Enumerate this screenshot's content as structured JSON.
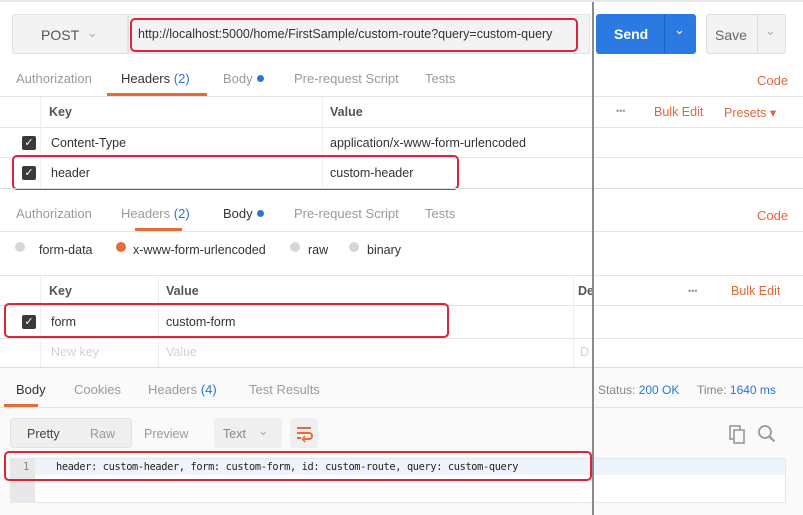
{
  "request": {
    "method": "POST",
    "url": "http://localhost:5000/home/FirstSample/custom-route?query=custom-query",
    "send_label": "Send",
    "save_label": "Save"
  },
  "request_tabs": {
    "authorization": "Authorization",
    "headers": "Headers",
    "headers_count": "(2)",
    "body": "Body",
    "prerequest": "Pre-request Script",
    "tests": "Tests",
    "code": "Code"
  },
  "headers_table": {
    "key_header": "Key",
    "value_header": "Value",
    "more": "•••",
    "bulk_edit": "Bulk Edit",
    "presets": "Presets ▾",
    "rows": [
      {
        "key": "Content-Type",
        "value": "application/x-www-form-urlencoded",
        "checked": true
      },
      {
        "key": "header",
        "value": "custom-header",
        "checked": true
      }
    ]
  },
  "body_options": {
    "form_data": "form-data",
    "urlencoded": "x-www-form-urlencoded",
    "raw": "raw",
    "binary": "binary",
    "selected": "x-www-form-urlencoded"
  },
  "body_table": {
    "key_header": "Key",
    "value_header": "Value",
    "desc_header": "De",
    "more": "•••",
    "bulk_edit": "Bulk Edit",
    "rows": [
      {
        "key": "form",
        "value": "custom-form",
        "checked": true
      }
    ],
    "new_key_placeholder": "New key",
    "new_value_placeholder": "Value",
    "new_desc_placeholder": "D"
  },
  "response": {
    "tabs": {
      "body": "Body",
      "cookies": "Cookies",
      "headers": "Headers",
      "headers_count": "(4)",
      "test_results": "Test Results"
    },
    "status_label": "Status:",
    "status_value": "200 OK",
    "time_label": "Time:",
    "time_value": "1640 ms",
    "view": {
      "pretty": "Pretty",
      "raw": "Raw",
      "preview": "Preview",
      "format": "Text"
    },
    "lines": [
      {
        "number": "1",
        "text": "header: custom-header, form: custom-form, id: custom-route, query: custom-query"
      }
    ]
  },
  "colors": {
    "accent": "#e46b3c",
    "send": "#2a7ae2",
    "highlight": "#d9263a"
  }
}
